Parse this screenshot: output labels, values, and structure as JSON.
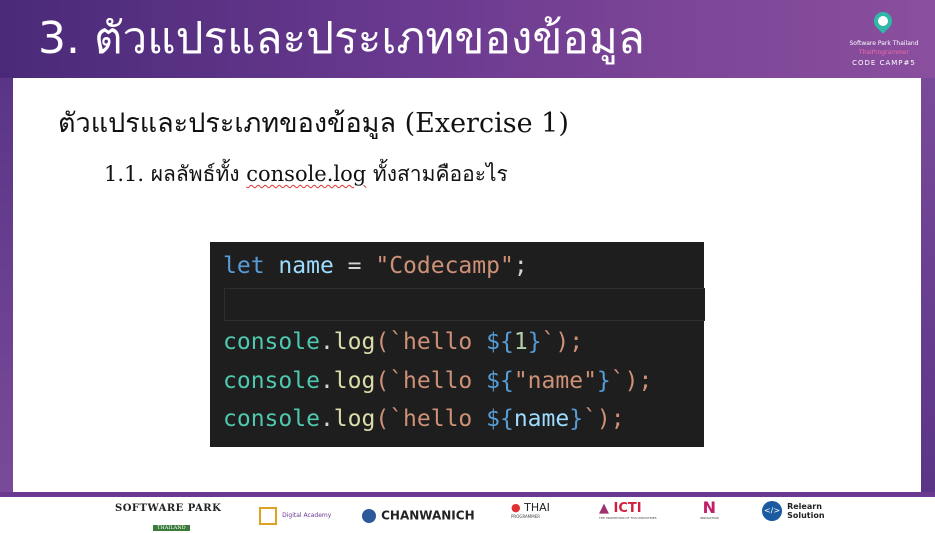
{
  "header": {
    "title": "3. ตัวแปรและประเภทของข้อมูล",
    "logo": {
      "line1": "Software Park Thailand",
      "line2": "ThaiProgrammer",
      "line3": "CODE CAMP#5"
    }
  },
  "content": {
    "heading": "ตัวแปรและประเภทของข้อมูล (Exercise 1)",
    "item_prefix": "1.1. ผลลัพธ์ทั้ง ",
    "item_code": "console.log",
    "item_suffix": " ทั้งสามคืออะไร"
  },
  "code": {
    "line1": {
      "kw": "let",
      "var": "name",
      "op": " = ",
      "str": "\"Codecamp\"",
      "end": ";"
    },
    "line3": {
      "obj": "console",
      "dot": ".",
      "fn": "log",
      "open": "(`hello ",
      "tpl_open": "${",
      "expr": "1",
      "tpl_close": "}",
      "close": "`);"
    },
    "line4": {
      "obj": "console",
      "dot": ".",
      "fn": "log",
      "open": "(`hello ",
      "tpl_open": "${",
      "expr": "\"name\"",
      "tpl_close": "}",
      "close": "`);"
    },
    "line5": {
      "obj": "console",
      "dot": ".",
      "fn": "log",
      "open": "(`hello ",
      "tpl_open": "${",
      "expr": "name",
      "tpl_close": "}",
      "close": "`);"
    }
  },
  "footer": {
    "logos": [
      {
        "main": "SOFTWARE PARK",
        "sub": "THAILAND"
      },
      {
        "main": "Digital Academy"
      },
      {
        "main": "CHANWANICH"
      },
      {
        "main": "THAI",
        "sub": "PROGRAMMER"
      },
      {
        "main": "ICTI",
        "sub": "THE PROMOTION OF THAI INDUSTRIES"
      },
      {
        "main": "N",
        "sub": "INNOVATION"
      },
      {
        "main": "Relearn",
        "sub": "Solution"
      }
    ]
  },
  "colors": {
    "header_start": "#4a2a78",
    "header_end": "#8a4f9e",
    "code_bg": "#1e1e1e",
    "keyword": "#569cd6",
    "variable": "#9cdcfe",
    "string": "#ce9178",
    "object": "#4ec9b0",
    "function": "#dcdcaa"
  }
}
